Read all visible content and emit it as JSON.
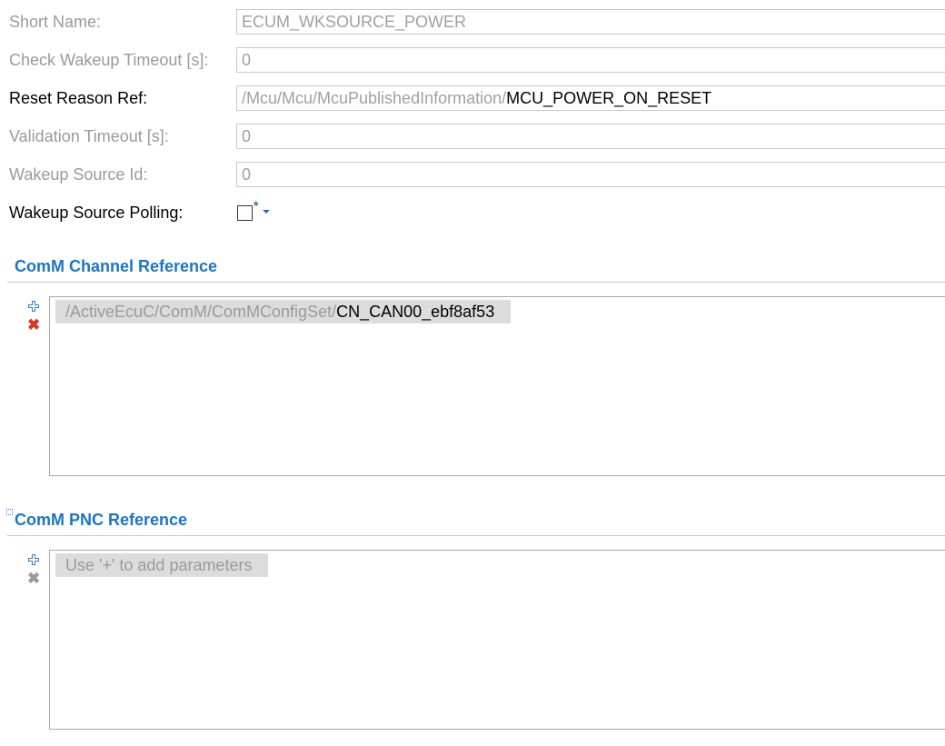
{
  "form": {
    "short_name": {
      "label": "Short Name:",
      "value": "ECUM_WKSOURCE_POWER"
    },
    "check_wakeup_timeout": {
      "label": "Check Wakeup Timeout [s]:",
      "value": "0"
    },
    "reset_reason_ref": {
      "label": "Reset Reason Ref:",
      "value_path": "/Mcu/Mcu/McuPublishedInformation/",
      "value_name": "MCU_POWER_ON_RESET"
    },
    "validation_timeout": {
      "label": "Validation Timeout [s]:",
      "value": "0"
    },
    "wakeup_source_id": {
      "label": "Wakeup Source Id:",
      "value": "0"
    },
    "wakeup_source_polling": {
      "label": "Wakeup Source Polling:",
      "checked": false,
      "default_marker": "*"
    }
  },
  "comm_channel": {
    "title": "ComM Channel Reference",
    "items": [
      {
        "path": "/ActiveEcuC/ComM/ComMConfigSet/",
        "name": "CN_CAN00_ebf8af53"
      }
    ]
  },
  "comm_pnc": {
    "title": "ComM PNC Reference",
    "placeholder": "Use '+' to add parameters"
  },
  "icons": {
    "add": "plus-icon",
    "remove": "delete-icon",
    "accent_color": "#1a75c7",
    "remove_active_color": "#d9381e",
    "remove_disabled_color": "#9a9a9a"
  }
}
